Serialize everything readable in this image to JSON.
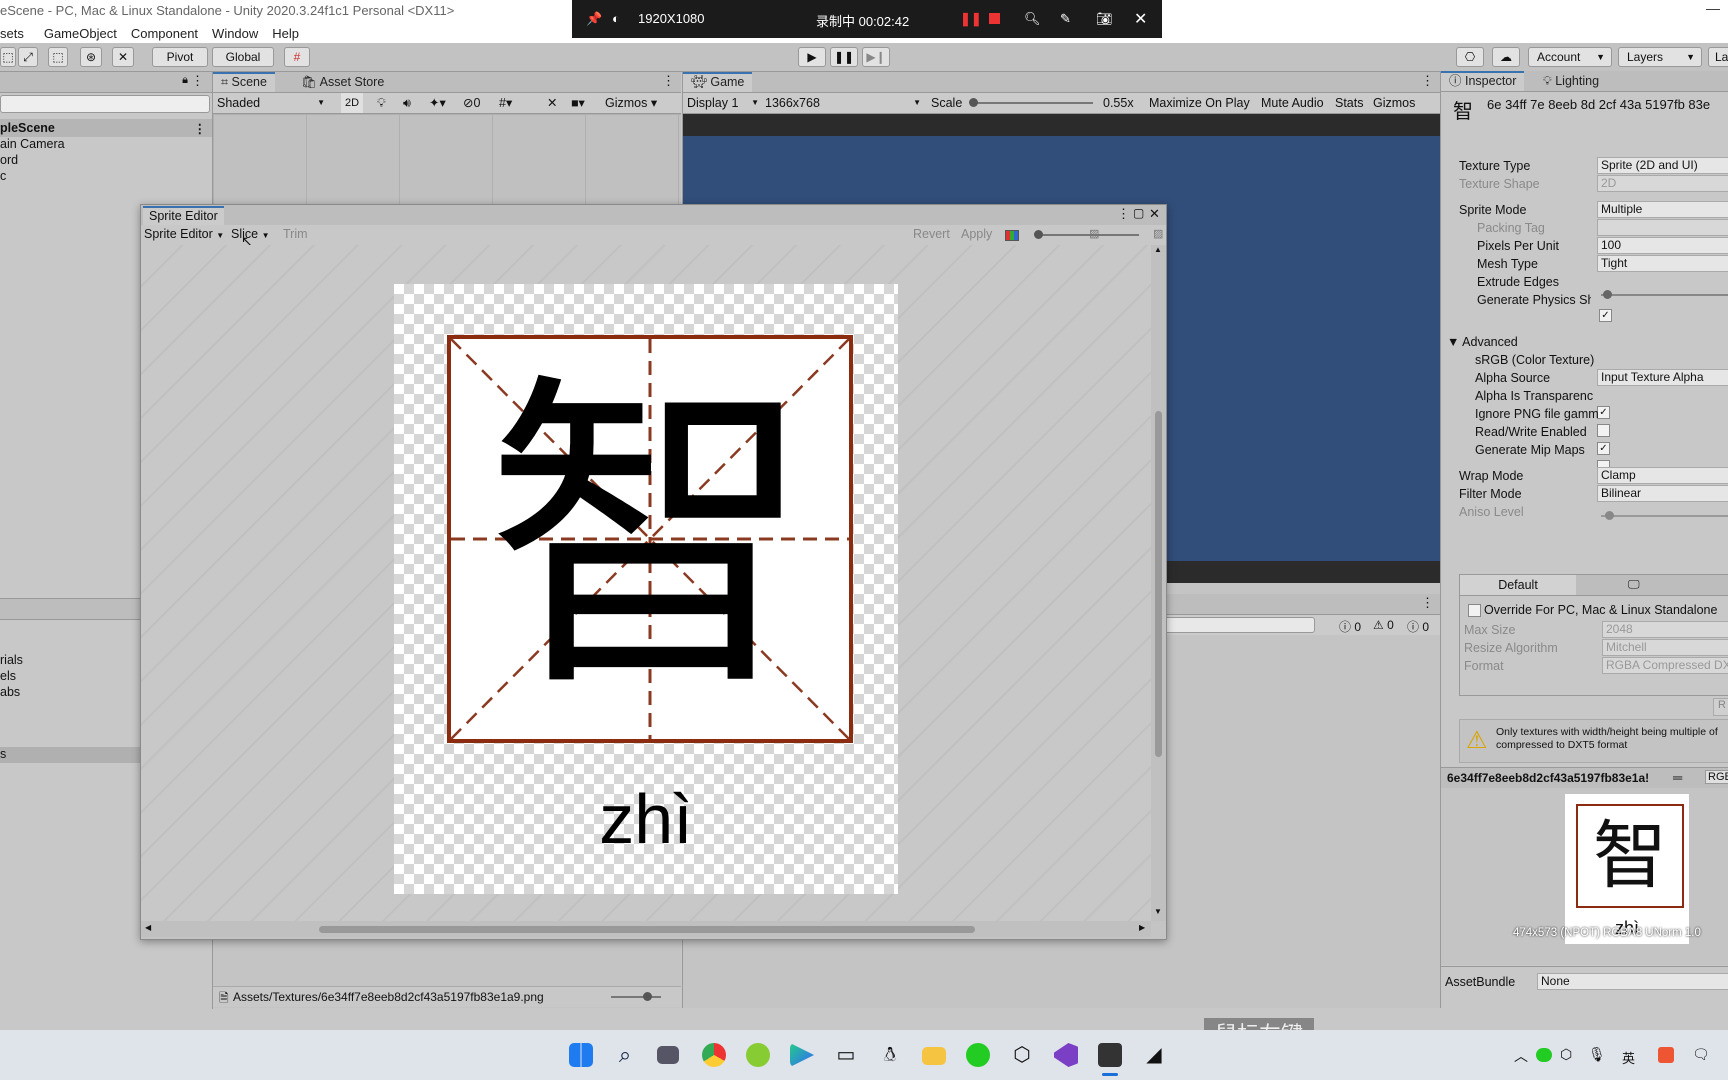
{
  "window": {
    "title": "eScene - PC, Mac & Linux Standalone - Unity 2020.3.24f1c1 Personal <DX11>"
  },
  "menu": [
    "sets",
    "GameObject",
    "Component",
    "Window",
    "Help"
  ],
  "recorder": {
    "resolution": "1920X1080",
    "status": "录制中 00:02:42"
  },
  "toolbar": {
    "pivot": "Pivot",
    "global": "Global",
    "account": "Account",
    "layers": "Layers",
    "layout": "La"
  },
  "hierarchy": {
    "scene": "pleScene",
    "items": [
      "ain Camera",
      "ord",
      "c"
    ]
  },
  "project": {
    "items": [
      "rials",
      "els",
      "abs",
      "s"
    ]
  },
  "scene_view": {
    "tabs": [
      "Scene",
      "Asset Store"
    ],
    "shading": "Shaded",
    "mode_2d": "2D",
    "hidden_count": "0",
    "gizmos": "Gizmos",
    "path": "Assets/Textures/6e34ff7e8eeb8d2cf43a5197fb83e1a9.png"
  },
  "game_view": {
    "tab": "Game",
    "display": "Display 1",
    "resolution": "1366x768",
    "scale_label": "Scale",
    "scale_value": "0.55x",
    "maximize": "Maximize On Play",
    "mute": "Mute Audio",
    "stats": "Stats",
    "gizmos": "Gizmos"
  },
  "console": {
    "errors": "0",
    "warnings": "0",
    "messages": "0"
  },
  "sprite_editor": {
    "title": "Sprite Editor",
    "mode": "Sprite Editor",
    "slice": "Slice",
    "trim": "Trim",
    "revert": "Revert",
    "apply": "Apply",
    "character": "智",
    "pinyin": "zhì"
  },
  "inspector": {
    "tabs": [
      "Inspector",
      "Lighting"
    ],
    "asset_name": "6e 34ff 7e 8eeb 8d 2cf 43a 5197fb 83e",
    "texture_type": {
      "label": "Texture Type",
      "value": "Sprite (2D and UI)"
    },
    "texture_shape": {
      "label": "Texture Shape",
      "value": "2D"
    },
    "sprite_mode": {
      "label": "Sprite Mode",
      "value": "Multiple"
    },
    "packing_tag": {
      "label": "Packing Tag",
      "value": ""
    },
    "pixels_per_unit": {
      "label": "Pixels Per Unit",
      "value": "100"
    },
    "mesh_type": {
      "label": "Mesh Type",
      "value": "Tight"
    },
    "extrude_edges": {
      "label": "Extrude Edges"
    },
    "generate_physics": {
      "label": "Generate Physics Sha",
      "checked": true
    },
    "advanced": "Advanced",
    "srgb": {
      "label": "sRGB (Color Texture)",
      "checked": true
    },
    "alpha_source": {
      "label": "Alpha Source",
      "value": "Input Texture Alpha"
    },
    "alpha_is_transparency": {
      "label": "Alpha Is Transparenc",
      "checked": true
    },
    "ignore_png": {
      "label": "Ignore PNG file gamm",
      "checked": false
    },
    "read_write": {
      "label": "Read/Write Enabled",
      "checked": true
    },
    "mip_maps": {
      "label": "Generate Mip Maps",
      "checked": false
    },
    "wrap_mode": {
      "label": "Wrap Mode",
      "value": "Clamp"
    },
    "filter_mode": {
      "label": "Filter Mode",
      "value": "Bilinear"
    },
    "aniso_level": {
      "label": "Aniso Level"
    },
    "platform_tab": "Default",
    "override": {
      "label": "Override For PC, Mac & Linux Standalone",
      "checked": false
    },
    "max_size": {
      "label": "Max Size",
      "value": "2048"
    },
    "resize_algorithm": {
      "label": "Resize Algorithm",
      "value": "Mitchell"
    },
    "format": {
      "label": "Format",
      "value": "RGBA Compressed DX"
    },
    "revert_button": "R",
    "warning": "Only textures with width/height being multiple of",
    "warning2": "compressed to DXT5 format",
    "preview_name": "6e34ff7e8eeb8d2cf43a5197fb83e1a!",
    "preview_channel": "RGB",
    "preview_info": "474x573 (NPOT)  RGBA8 UNorm  1.0",
    "preview_char": "智",
    "preview_pinyin": "zhì",
    "assetbundle_label": "AssetBundle",
    "assetbundle_value": "None"
  },
  "overlay_text": "鼠标左键",
  "systray": {
    "ime": "英"
  }
}
